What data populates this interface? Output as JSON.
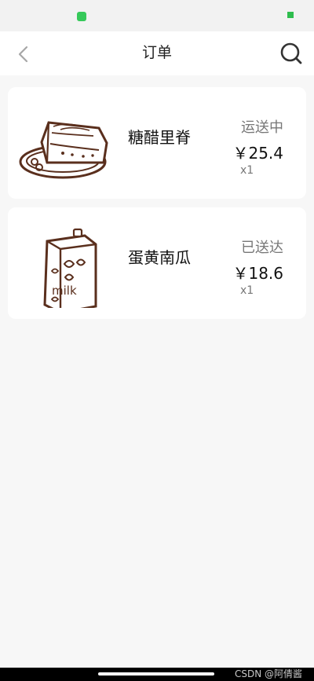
{
  "header": {
    "title": "订单",
    "back_icon": "chevron-left-icon",
    "search_icon": "search-icon"
  },
  "orders": [
    {
      "name": "糖醋里脊",
      "status": "运送中",
      "price": "￥25.4",
      "quantity": "x1",
      "image_icon": "cake-slice-icon"
    },
    {
      "name": "蛋黄南瓜",
      "status": "已送达",
      "price": "￥18.6",
      "quantity": "x1",
      "image_icon": "milk-carton-icon"
    }
  ],
  "watermark": "CSDN @阿倩酱",
  "colors": {
    "page_background": "#f7f7f7",
    "card_background": "#ffffff",
    "status_text": "#777777",
    "primary_text": "#111111",
    "illustration": "#5a2f1d"
  }
}
